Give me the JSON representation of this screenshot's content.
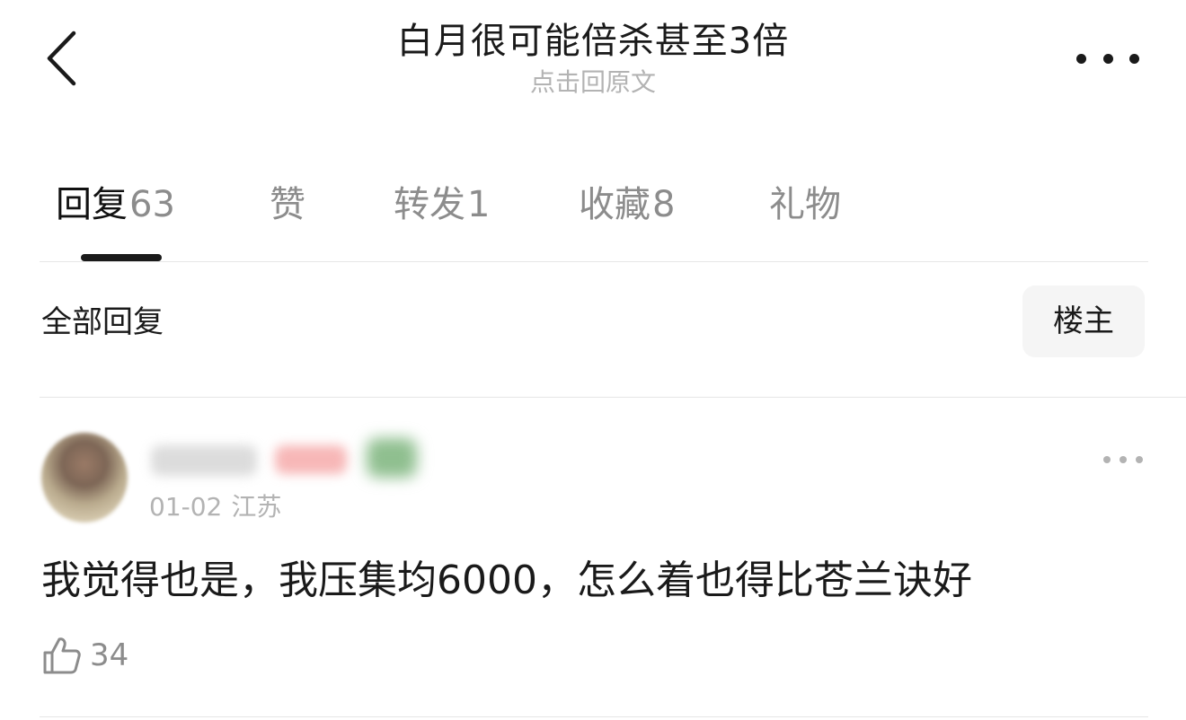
{
  "header": {
    "title": "白月很可能倍杀甚至3倍",
    "subtitle": "点击回原文"
  },
  "tabs": [
    {
      "label": "回复",
      "count": "63",
      "active": true
    },
    {
      "label": "赞",
      "count": ""
    },
    {
      "label": "转发",
      "count": "1"
    },
    {
      "label": "收藏",
      "count": "8"
    },
    {
      "label": "礼物",
      "count": ""
    }
  ],
  "filter": {
    "all_label": "全部回复",
    "op_label": "楼主"
  },
  "comment": {
    "date": "01-02",
    "location": "江苏",
    "text": "我觉得也是，我压集均6000，怎么着也得比苍兰诀好",
    "likes": "34"
  },
  "icons": {
    "back": "chevron-left-icon",
    "more": "more-horizontal-icon",
    "like": "thumbs-up-icon"
  },
  "colors": {
    "text_primary": "#1a1a1a",
    "text_secondary": "#8c8c8c",
    "text_muted": "#b3b3b3",
    "chip_bg": "#f5f5f5"
  }
}
